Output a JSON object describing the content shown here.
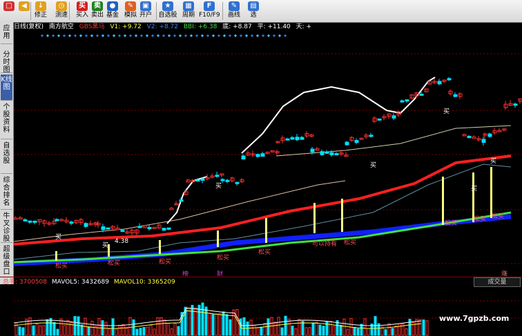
{
  "toolbar": {
    "items": [
      {
        "label": "",
        "icon": "home-icon",
        "color": "#d03030"
      },
      {
        "label": "",
        "icon": "back-icon",
        "color": "#e0a020"
      },
      {
        "label": "修正",
        "icon": "edit-icon",
        "color": "#e0a020"
      },
      {
        "label": "测速",
        "icon": "speed-icon",
        "color": "#e0a020"
      },
      {
        "label": "买入",
        "icon": "buy-icon",
        "color": "#d02020"
      },
      {
        "label": "卖出",
        "icon": "sell-icon",
        "color": "#208020"
      },
      {
        "label": "基金",
        "icon": "fund-icon",
        "color": "#2060c0"
      },
      {
        "label": "模拟",
        "icon": "simulate-icon",
        "color": "#e06020"
      },
      {
        "label": "开户",
        "icon": "account-icon",
        "color": "#3070d0"
      },
      {
        "label": "自选股",
        "icon": "star-icon",
        "color": "#3070d0"
      },
      {
        "label": "周期",
        "icon": "period-icon",
        "color": "#3070d0"
      },
      {
        "label": "F10/F9",
        "icon": "f10-icon",
        "color": "#3070d0"
      },
      {
        "label": "画线",
        "icon": "draw-icon",
        "color": "#3070d0"
      },
      {
        "label": "选",
        "icon": "select-icon",
        "color": "#3070d0"
      }
    ]
  },
  "sidebar": {
    "items": [
      {
        "label": "应用"
      },
      {
        "label": "分时图"
      },
      {
        "label": "K线图",
        "active": true
      },
      {
        "label": "个股资料"
      },
      {
        "label": "自选股"
      },
      {
        "label": "综合排名"
      },
      {
        "label": "牛叉诊股"
      },
      {
        "label": "超级盘口"
      }
    ]
  },
  "header": {
    "chart_type": "日线(复权)",
    "stock_name": "南方航空",
    "indicator": "GBS黑马",
    "v1": "V1: +9.72",
    "v2": "V2: +8.72",
    "bbi": "BBI: +6.38",
    "bottom": "底: +8.87",
    "flat": "平: +11.40",
    "sky": "天: +"
  },
  "chart_labels": {
    "buy": "买",
    "loose_buy": "松买",
    "tradable": "可以持有",
    "price_label": "4.38",
    "event1": "榜",
    "event2": "财",
    "limit_up": "涨"
  },
  "volume": {
    "total_label": "总手: 3700508",
    "mavol5": "MAVOL5: 3432689",
    "mavol10": "MAVOL10: 3365209",
    "selector": "成交量",
    "watermark": "www.7gpzb.com"
  },
  "colors": {
    "up": "#ff3030",
    "down": "#00e0ff",
    "ma_white": "#ffffff",
    "ma_red": "#ff2020",
    "ma_green": "#40e040",
    "ma_blue": "#1020ff",
    "signal_yellow": "#ffff80"
  }
}
